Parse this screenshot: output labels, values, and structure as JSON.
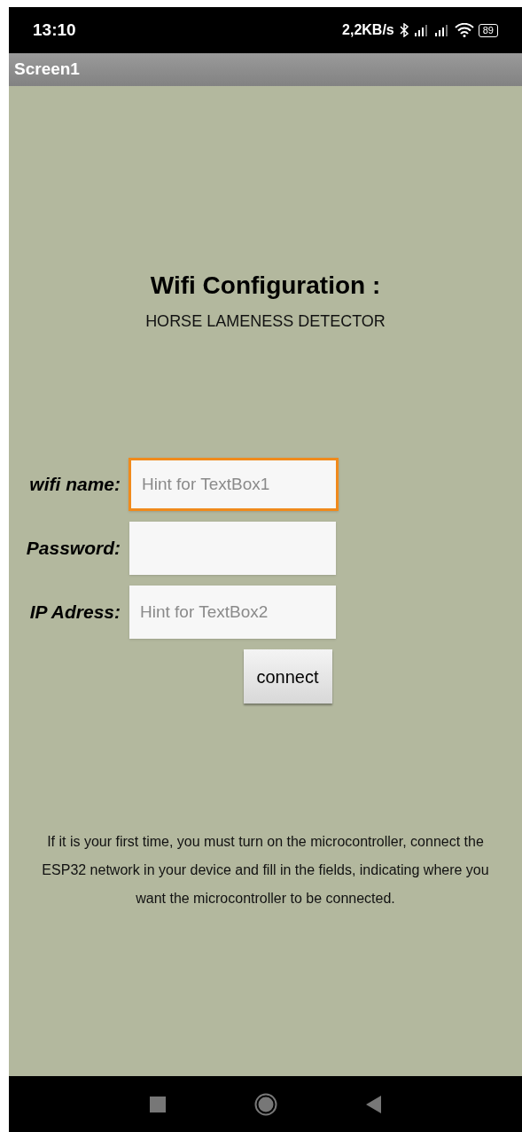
{
  "status_bar": {
    "time": "13:10",
    "speed": "2,2KB/s",
    "battery": "89"
  },
  "title_bar": {
    "title": "Screen1"
  },
  "heading": "Wifi Configuration :",
  "subtitle": "HORSE LAMENESS DETECTOR",
  "fields": [
    {
      "label": "wifi name:",
      "placeholder": "Hint for TextBox1",
      "focused": true
    },
    {
      "label": "Password:",
      "focused": false
    },
    {
      "label": "IP Adress:",
      "placeholder": "Hint for TextBox2",
      "focused": false
    }
  ],
  "button": "connect",
  "info": "If it is your first time, you must turn on the microcontroller, connect the ESP32 network in your device and fill in the fields, indicating where you want the microcontroller to be connected."
}
